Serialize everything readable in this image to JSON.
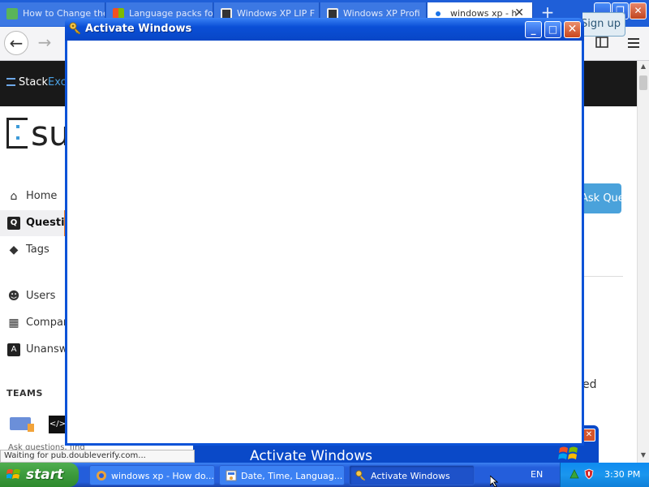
{
  "browser": {
    "tabs": [
      {
        "label": "How to Change the",
        "icon": "site-icon",
        "color": "#5ab45a"
      },
      {
        "label": "Language packs for",
        "icon": "microsoft-icon",
        "color": "#f25022"
      },
      {
        "label": "Windows XP LIP F",
        "icon": "page-icon",
        "color": "#333333"
      },
      {
        "label": "Windows XP Profi",
        "icon": "page-icon",
        "color": "#333333"
      },
      {
        "label": "windows xp - h",
        "icon": "dot-icon",
        "color": "#1a73e8"
      }
    ],
    "new_tab": "+",
    "window_buttons": {
      "minimize": "_",
      "maximize": "❐",
      "close": "✕"
    },
    "back": "←",
    "forward": "→"
  },
  "page": {
    "stack_exchange": {
      "stack": "Stack",
      "exc": "Exc"
    },
    "sign_up": "Sign up",
    "site_logo_text": "su",
    "nav": [
      {
        "label": "Home",
        "icon": "home-icon",
        "glyph": "⌂"
      },
      {
        "label": "Questions",
        "icon": "questions-icon",
        "glyph": "Q"
      },
      {
        "label": "Tags",
        "icon": "tag-icon",
        "glyph": "◆"
      },
      {
        "label": "Users",
        "icon": "users-icon",
        "glyph": "☻"
      },
      {
        "label": "Companies",
        "icon": "companies-icon",
        "glyph": "▦"
      },
      {
        "label": "Unanswered",
        "icon": "unanswered-icon",
        "glyph": "A"
      }
    ],
    "teams_heading": "TEAMS",
    "ask_questions_small": "Ask questions, find",
    "ask_question_button": "Ask Question",
    "ed_text": "ed",
    "status": "Waiting for pub.doubleverify.com..."
  },
  "background_window": {
    "title": "Activate Windows",
    "close": "✕"
  },
  "dialog": {
    "title": "Activate Windows",
    "minimize": "_",
    "maximize": "□",
    "close": "✕"
  },
  "taskbar": {
    "start": "start",
    "buttons": [
      {
        "label": "windows xp - How do...",
        "icon": "browser-icon"
      },
      {
        "label": "Date, Time, Languag...",
        "icon": "control-panel-icon"
      },
      {
        "label": "Activate Windows",
        "icon": "key-icon",
        "active": true
      }
    ],
    "language": "EN",
    "clock": "3:30 PM"
  }
}
